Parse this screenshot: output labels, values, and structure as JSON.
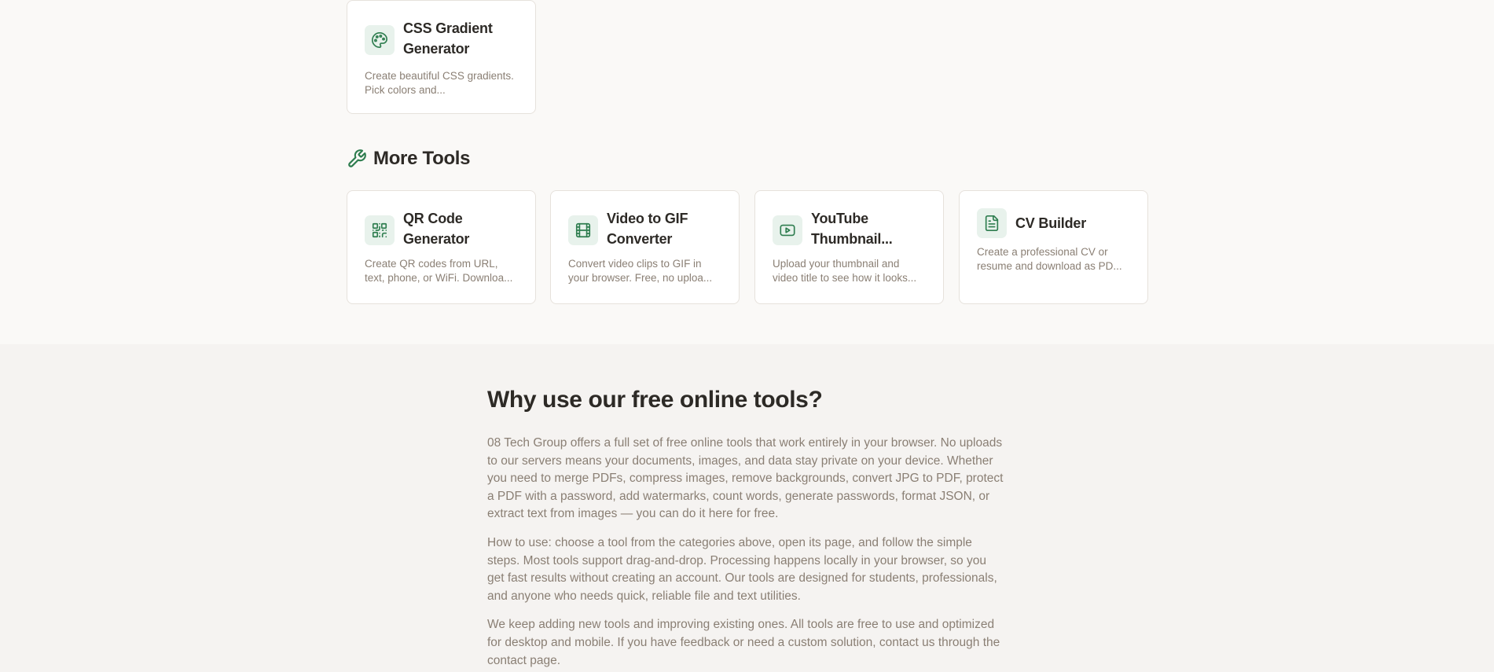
{
  "top_cards": [
    {
      "title": "CSS Gradient Generator",
      "description": "Create beautiful CSS gradients. Pick colors and...",
      "icon": "palette-icon"
    }
  ],
  "more_tools": {
    "heading": "More Tools",
    "icon": "wrench-icon",
    "cards": [
      {
        "title": "QR Code Generator",
        "description": "Create QR codes from URL, text, phone, or WiFi. Downloa...",
        "icon": "qr-code-icon"
      },
      {
        "title": "Video to GIF Converter",
        "description": "Convert video clips to GIF in your browser. Free, no uploa...",
        "icon": "film-icon"
      },
      {
        "title": "YouTube Thumbnail...",
        "description": "Upload your thumbnail and video title to see how it looks...",
        "icon": "youtube-icon"
      },
      {
        "title": "CV Builder",
        "description": "Create a professional CV or resume and download as PD...",
        "icon": "document-icon"
      }
    ]
  },
  "why": {
    "title": "Why use our free online tools?",
    "paragraphs": [
      "08 Tech Group offers a full set of free online tools that work entirely in your browser. No uploads to our servers means your documents, images, and data stay private on your device. Whether you need to merge PDFs, compress images, remove backgrounds, convert JPG to PDF, protect a PDF with a password, add watermarks, count words, generate passwords, format JSON, or extract text from images — you can do it here for free.",
      "How to use: choose a tool from the categories above, open its page, and follow the simple steps. Most tools support drag-and-drop. Processing happens locally in your browser, so you get fast results without creating an account. Our tools are designed for students, professionals, and anyone who needs quick, reliable file and text utilities.",
      "We keep adding new tools and improving existing ones. All tools are free to use and optimized for desktop and mobile. If you have feedback or need a custom solution, contact us through the contact page."
    ]
  },
  "colors": {
    "accent": "#2e7d4f",
    "icon_bg": "#e8f2ec",
    "text_muted": "#8a7f74",
    "heading": "#2d2a26"
  }
}
